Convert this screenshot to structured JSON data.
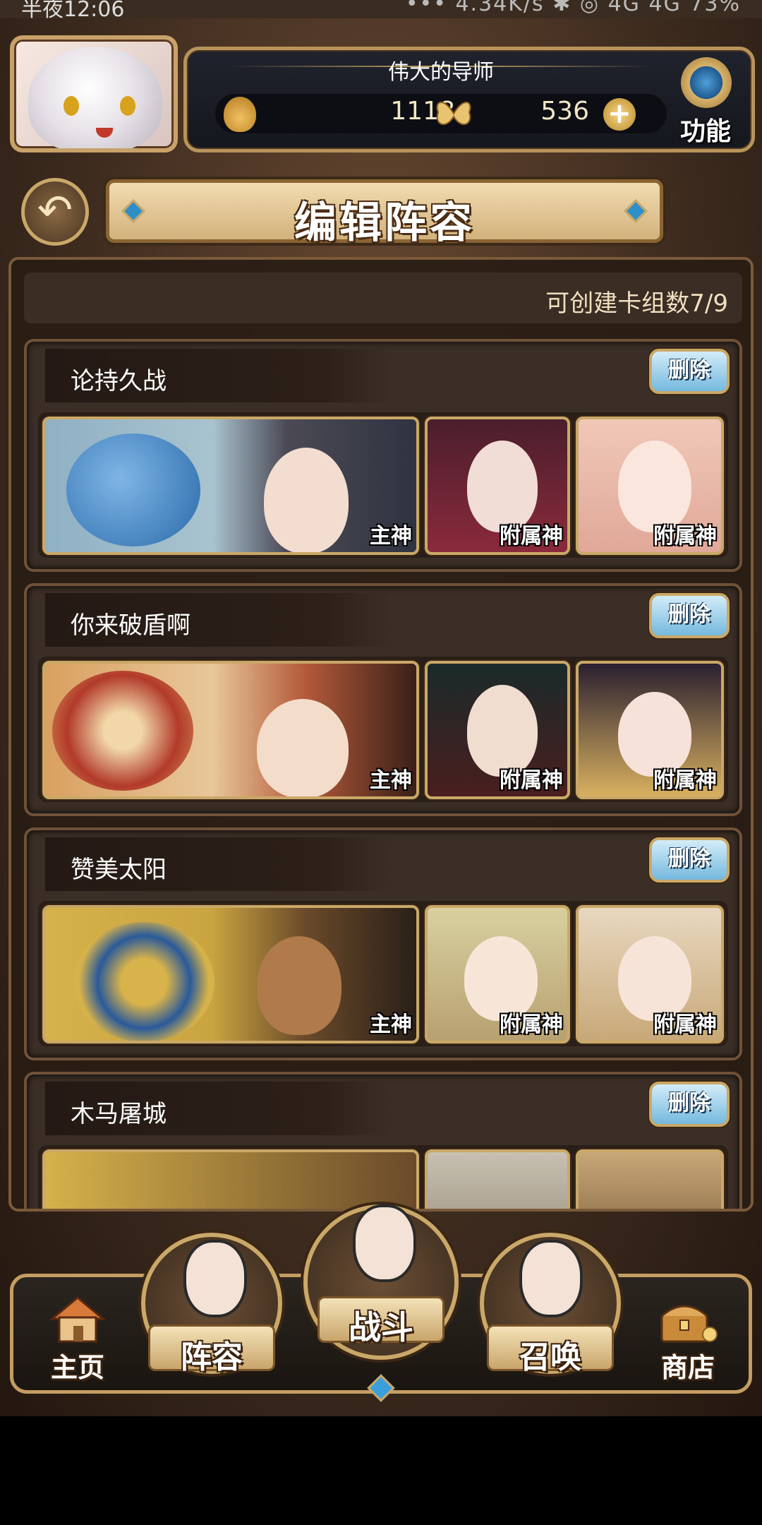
{
  "status_bar": {
    "time": "半夜12:06",
    "info": "••• 4.34K/s ✱ ◎ 4G 4G 73%"
  },
  "header": {
    "player_name": "伟大的导师",
    "resource1": "1118",
    "resource2": "536",
    "plus": "+",
    "function_label": "功能"
  },
  "title": {
    "back": "↶",
    "text": "编辑阵容"
  },
  "deck_count": "可创建卡组数7/9",
  "decks": [
    {
      "name": "论持久战",
      "delete": "删除",
      "main": "主神",
      "sub1": "附属神",
      "sub2": "附属神"
    },
    {
      "name": "你来破盾啊",
      "delete": "删除",
      "main": "主神",
      "sub1": "附属神",
      "sub2": "附属神"
    },
    {
      "name": "赞美太阳",
      "delete": "删除",
      "main": "主神",
      "sub1": "附属神",
      "sub2": "附属神"
    },
    {
      "name": "木马屠城",
      "delete": "删除"
    }
  ],
  "nav": {
    "home": "主页",
    "lineup": "阵容",
    "battle": "战斗",
    "summon": "召唤",
    "shop": "商店"
  },
  "colors": {
    "gold": "#caa868",
    "panel": "#3b2e26",
    "delete_blue": "#75b9de"
  }
}
